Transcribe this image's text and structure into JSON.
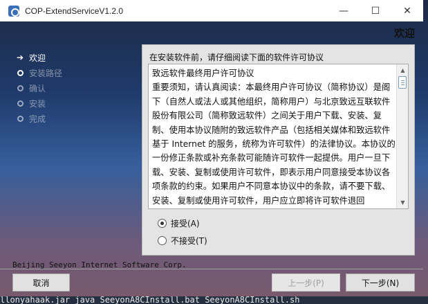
{
  "window": {
    "title": "COP-ExtendServiceV1.2.0",
    "minimize": "—",
    "maximize": "☐",
    "close": "✕"
  },
  "header": {
    "title": "欢迎"
  },
  "steps": [
    {
      "label": "欢迎",
      "state": "current"
    },
    {
      "label": "安装路径",
      "state": "pending"
    },
    {
      "label": "确认",
      "state": "pending"
    },
    {
      "label": "安装",
      "state": "pending"
    },
    {
      "label": "完成",
      "state": "pending"
    }
  ],
  "panel": {
    "instruction": "在安装软件前，请仔细阅读下面的软件许可协议",
    "license_text": "致远软件最终用户许可协议\n重要须知，请认真阅读：本最终用户许可协议（简称协议）是阁下（自然人或法人或其他组织，简称用户）与北京致远互联软件股份有限公司（简称致远软件）之间关于用户下载、安装、复制、使用本协议随附的致远软件产品（包括相关媒体和致远软件基于 Internet 的服务，统称为许可软件）的法律协议。本协议的一份修正条款或补充条款可能随许可软件一起提供。用户一旦下载、安装、复制或使用许可软件，即表示用户同意接受本协议各项条款的约束。如果用户不同意本协议中的条款，请不要下载、安装、复制或使用许可软件，用户应立即将许可软件退回",
    "accept_label": "接受(A)",
    "decline_label": "不接受(T)",
    "selected": "accept"
  },
  "footer": {
    "company": "Beijing Seeyon Internet Software Corp.",
    "cancel_label": "取消",
    "prev_label": "上一步(P)",
    "next_label": "下一步(N)"
  },
  "background": {
    "terminal_line": "llonyahaak.jar  java  SeeyonA8CInstall.bat  SeeyonA8CInstall.sh"
  },
  "colors": {
    "panel_bg": "#e4e4e4",
    "button_bg": "#e1e1e1",
    "title_bar": "#ffffff"
  }
}
